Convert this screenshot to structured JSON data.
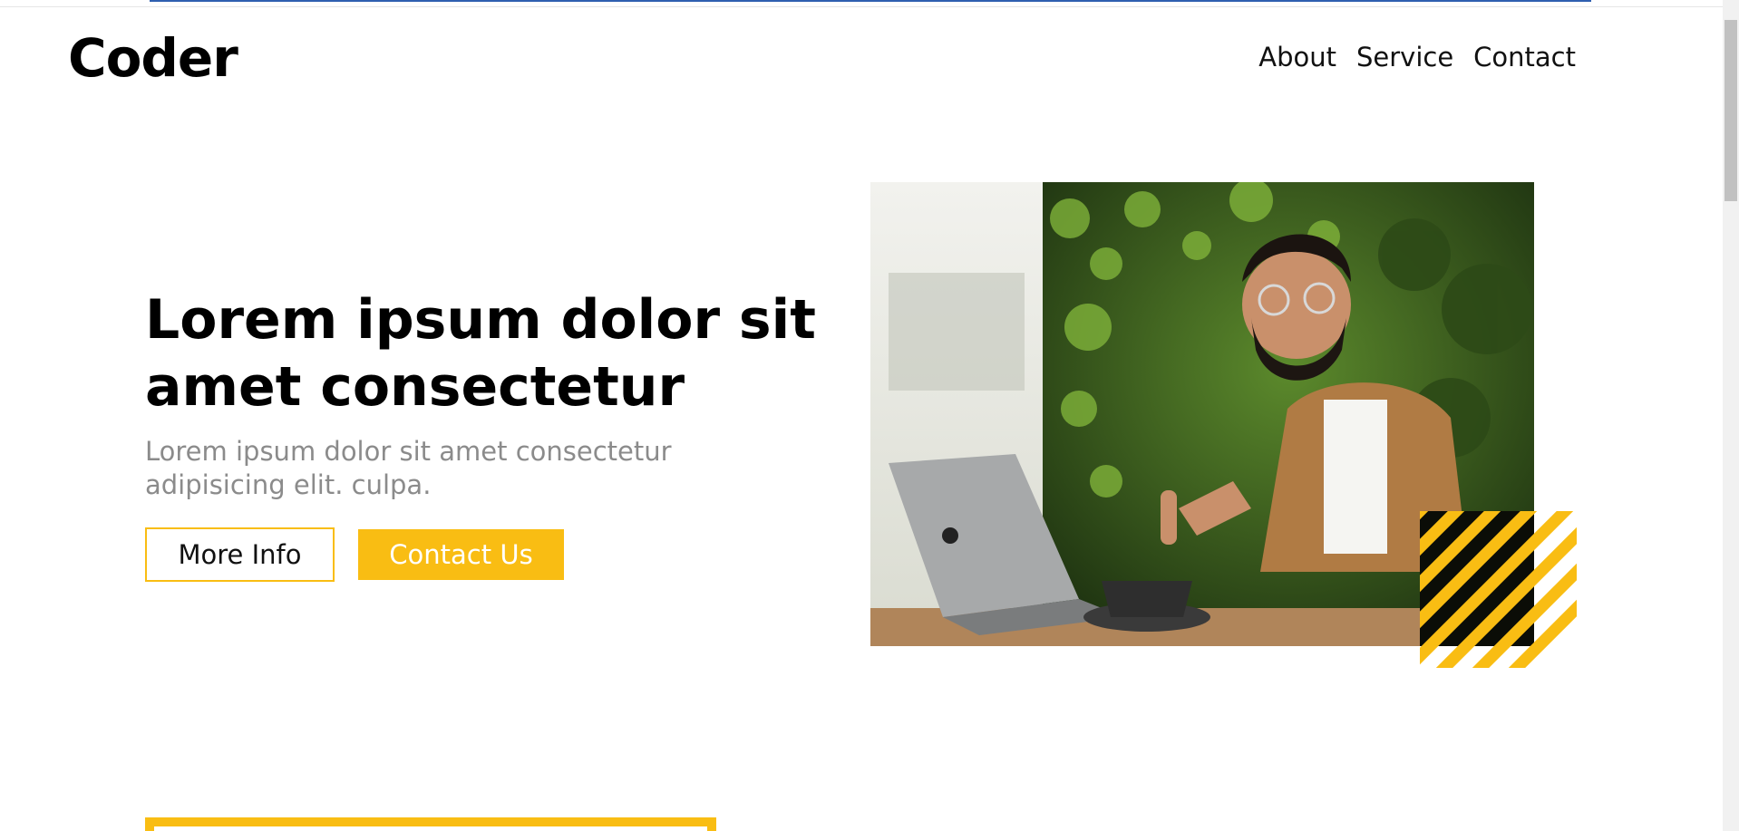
{
  "brand": {
    "logo": "Coder"
  },
  "nav": {
    "items": [
      "About",
      "Service",
      "Contact"
    ]
  },
  "hero": {
    "title_line1": "Lorem ipsum dolor sit",
    "title_line2": "amet consectetur",
    "subtitle_line1": "Lorem ipsum dolor sit amet consectetur",
    "subtitle_line2": "adipisicing elit. culpa.",
    "more_info_label": "More Info",
    "contact_label": "Contact Us",
    "image_alt": "man with laptop giving thumbs up"
  },
  "colors": {
    "accent": "#f9bd13",
    "text": "#111111",
    "muted": "#8b8b8b",
    "progress_bar": "#2f5fb0"
  },
  "icons": {
    "hero_decoration": "yellow-black-stripes"
  }
}
